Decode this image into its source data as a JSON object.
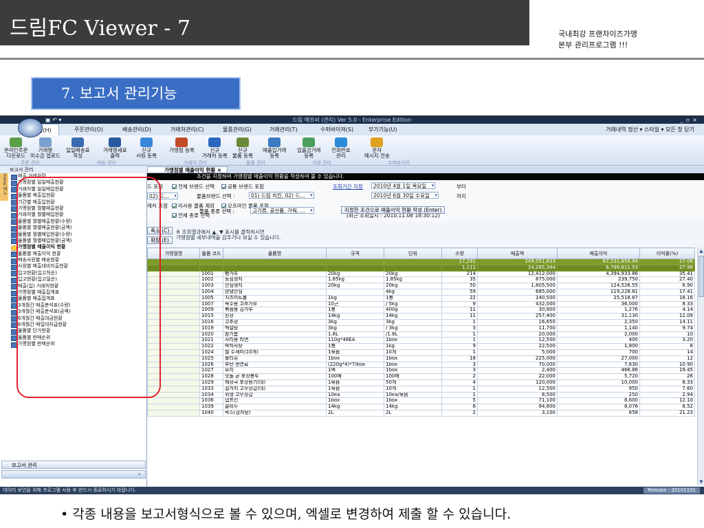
{
  "slide": {
    "title": "드림FC Viewer - 7",
    "tagline1": "국내최강 프랜차이즈가맹",
    "tagline2": "본부 관리프로그램 !!!",
    "section_title": "7. 보고서 관리기능",
    "bullet": "• 각종 내용을 보고서형식으로 볼 수 있으며, 엑셀로 변경하여 제출 할 수 있습니다."
  },
  "app": {
    "window_title": "드림 에프씨 (관리) Ver 5.0 - Enterprise Edition",
    "menus": [
      "홈(H)",
      "주문관리(O)",
      "배송관리(D)",
      "거래처관리(C)",
      "물품관리(G)",
      "거래관리(T)",
      "수퍼바이져(S)",
      "부가기능(U)"
    ],
    "menu_right": "거래내역 정산 ▾ 스타일 ▾ 모든 창 닫기",
    "ribbon": [
      {
        "label": "온라인주문\n다운로드",
        "color": "#5aa048"
      },
      {
        "label": "거래명\n미수금 업로드",
        "color": "#7aa0d0"
      },
      {
        "label": "일일배송표\n작성",
        "color": "#3a6ab0"
      },
      {
        "label": "거래명세표\n출력",
        "color": "#2a5aa0"
      },
      {
        "label": "신규\n사원 등록",
        "color": "#3a86d8"
      },
      {
        "label": "가맹점 등록",
        "color": "#c04a2a"
      },
      {
        "label": "신규\n거래처 등록",
        "color": "#2a66c0"
      },
      {
        "label": "신규\n물품 등록",
        "color": "#6a8a3a"
      },
      {
        "label": "매출입거래\n등록",
        "color": "#3a7ac0"
      },
      {
        "label": "입출금거래\n등록",
        "color": "#4aa05a"
      },
      {
        "label": "전화번호\n관리",
        "color": "#2a8ad8"
      },
      {
        "label": "문자\n메시지 전송",
        "color": "#e0a020"
      }
    ],
    "groups": [
      "주문 관리",
      "배송 관리",
      "거래처 관리",
      "물품 관리",
      "거래 관리",
      "수퍼바이저"
    ]
  },
  "sidebar": {
    "header": "보고서 관리",
    "tab": "Home 메뉴",
    "items": [
      "매출 거래처장",
      "가맹점별 일일매출현황",
      "거래처별 일일매입현황",
      "물품별 매출입현황",
      "기간별 매출입현황",
      "가맹점별 월별매출현황",
      "거래처별 월별매입현황",
      "물품별 월별매출현황(수량)",
      "물품별 월별매출현황(금액)",
      "물품별 월별매입현황(수량)",
      "물품별 월별매입현황(금액)",
      "가맹점별 매출이익 현황",
      "물품별 매출이익 현황",
      "배송사원별 배송현황",
      "사원별 매출대비지출현황",
      "입고현황(입고처순)",
      "입고현황(입고일순)",
      "매출(입) 거래처현황",
      "가맹점별 매출집계표",
      "물품별 매출집계표",
      "3개월간 매출분석표(수량)",
      "3개월간 매출분석표(금액)",
      "6개월간 매출대금현황",
      "6개월간 매입대지급현황",
      "물품별 단가현황",
      "물품별 판매순위",
      "가맹점별 판매순위"
    ],
    "active_index": 11,
    "footer": "보고서 관리",
    "footer2": "»"
  },
  "report": {
    "tab": "가맹점별 매출이익 현황",
    "instruction": "조건을 지정하여 가맹점별 매출이익 현황을 작성하여 볼 수 있습니다.",
    "f_left1": "드 포함",
    "f_left2": "02) 드...",
    "f_left3": "래처 포함",
    "cb_all_brand": "전체 브랜드 선택",
    "cb_common": "공통 브랜드 포함",
    "period_link": "조회기간 지정",
    "date_from": "2010년  4월  1일 목요일",
    "from": "부터",
    "brand_label": "물품브랜드 선택 :",
    "brand_value": "01) 드림 치킨, 02) 드...",
    "date_to": "2010년  6월 30일 수요일",
    "to": "까지",
    "cb_unused": "미사용 물품 제외",
    "cb_offline": "오프라인 물품 포함",
    "cb_all_kind": "전체 종류 선택",
    "latest": "(최근 조회일시 : 2010.11.08 18:30:12)",
    "kind_label": "물품 종류 선택 :",
    "kind_value": "고기류, 공산품, 가워, ...",
    "run_button": "지정한 조건으로 매출이익 현황 작성 (Enter)",
    "shrink": "축소 (C)",
    "expand": "확장 (E)",
    "hint1": "※ 조회결과에서 ▲, ▼ 표시를 클릭하시면",
    "hint2": "가맹점별 세부내역을 감추거나 보실 수 있습니다.",
    "columns": [
      "가맹점명",
      "물품 코드",
      "물품명",
      "규격",
      "단위",
      "수량",
      "매출액",
      "매출이익",
      "이익률(%)"
    ],
    "sum1": {
      "qty": "17,291",
      "sales": "249,551,833",
      "profit": "67,531,855.94",
      "rate": "27.06"
    },
    "sum2": {
      "qty": "1,111",
      "sales": "24,285,344",
      "profit": "6,789,611.53",
      "rate": "27.96"
    },
    "rows": [
      [
        "1001",
        "빵가루",
        "20kg",
        "20kg",
        "214",
        "12,412,000",
        "4,394,933.86",
        "35.41"
      ],
      [
        "1002",
        "등심생지",
        "1.85kg",
        "1.85kg",
        "35",
        "875,000",
        "239,750",
        "27.40"
      ],
      [
        "1003",
        "안심생지",
        "20kg",
        "20kg",
        "50",
        "1,805,500",
        "124,526.55",
        "6.90"
      ],
      [
        "1004",
        "양념안심",
        "",
        "4kg",
        "59",
        "685,000",
        "119,228.81",
        "17.41"
      ],
      [
        "1005",
        "치즈미트볼",
        "1kg",
        "1봉",
        "22",
        "140,500",
        "25,518.87",
        "18.16"
      ],
      [
        "1007",
        "옥수용 고추가루",
        "10근",
        "/ 5kg",
        "9",
        "432,000",
        "36,000",
        "8.33"
      ],
      [
        "1009",
        "볶음용 김가루",
        "1봉",
        "400g",
        "11",
        "30,800",
        "1,276",
        "4.14"
      ],
      [
        "1015",
        "된장",
        "14kg",
        "14kg",
        "11",
        "257,400",
        "31,130",
        "12.09"
      ],
      [
        "1016",
        "고추장",
        "3kg",
        "3kg",
        "1",
        "16,650",
        "2,350",
        "14.11"
      ],
      [
        "1019",
        "백설탕",
        "3kg",
        "/ 3kg",
        "3",
        "11,700",
        "1,140",
        "9.74"
      ],
      [
        "1020",
        "참기름",
        "1.8L",
        "/1.8L",
        "1",
        "20,000",
        "2,000",
        "10"
      ],
      [
        "1021",
        "사리용 라면",
        "110g*48EA",
        "1box",
        "1",
        "12,500",
        "400",
        "3.20"
      ],
      [
        "1022",
        "박하사탕",
        "1봉",
        "1kg",
        "9",
        "22,500",
        "1,800",
        "8"
      ],
      [
        "1024",
        "철 수세미(10개)",
        "1묶음",
        "10개",
        "1",
        "5,000",
        "700",
        "14"
      ],
      [
        "1025",
        "롤티슈",
        "1box",
        "1box",
        "18",
        "225,000",
        "27,000",
        "12"
      ],
      [
        "1026",
        "부탄 썬연료",
        "(220g*4)*7/box",
        "1box",
        "3",
        "70,000",
        "7,630",
        "10.90"
      ],
      [
        "1027",
        "요지",
        "1팩",
        "1box",
        "3",
        "2,400",
        "466.86",
        "19.45"
      ],
      [
        "1028",
        "맛돌 곧 포장봉투",
        "100매",
        "100매",
        "2",
        "22,000",
        "5,720",
        "26"
      ],
      [
        "1029",
        "해장국 포장용기(대)",
        "1묶음",
        "50개",
        "4",
        "120,000",
        "10,000",
        "8.33"
      ],
      [
        "1033",
        "설거지 고무장갑(대)",
        "1묶음",
        "10개",
        "1",
        "12,500",
        "950",
        "7.60"
      ],
      [
        "1034",
        "위생 고무장갑",
        "10ea",
        "10ea/묶음",
        "1",
        "8,500",
        "250",
        "2.94"
      ],
      [
        "1036",
        "냅프킨",
        "1box",
        "1box",
        "5",
        "71,100",
        "8,600",
        "12.10"
      ],
      [
        "1039",
        "콜비누",
        "14kg",
        "14kg",
        "6",
        "94,800",
        "8,076",
        "8.52"
      ],
      [
        "1040",
        "락스(감자탕)",
        "2L",
        "2L",
        "2",
        "3,100",
        "658",
        "21.23"
      ]
    ]
  },
  "status": {
    "text": "데이터 보안을 위해 프로그램 사용 후 반드시 종료하시기 바랍니다.",
    "release": "Release - 20101101"
  }
}
